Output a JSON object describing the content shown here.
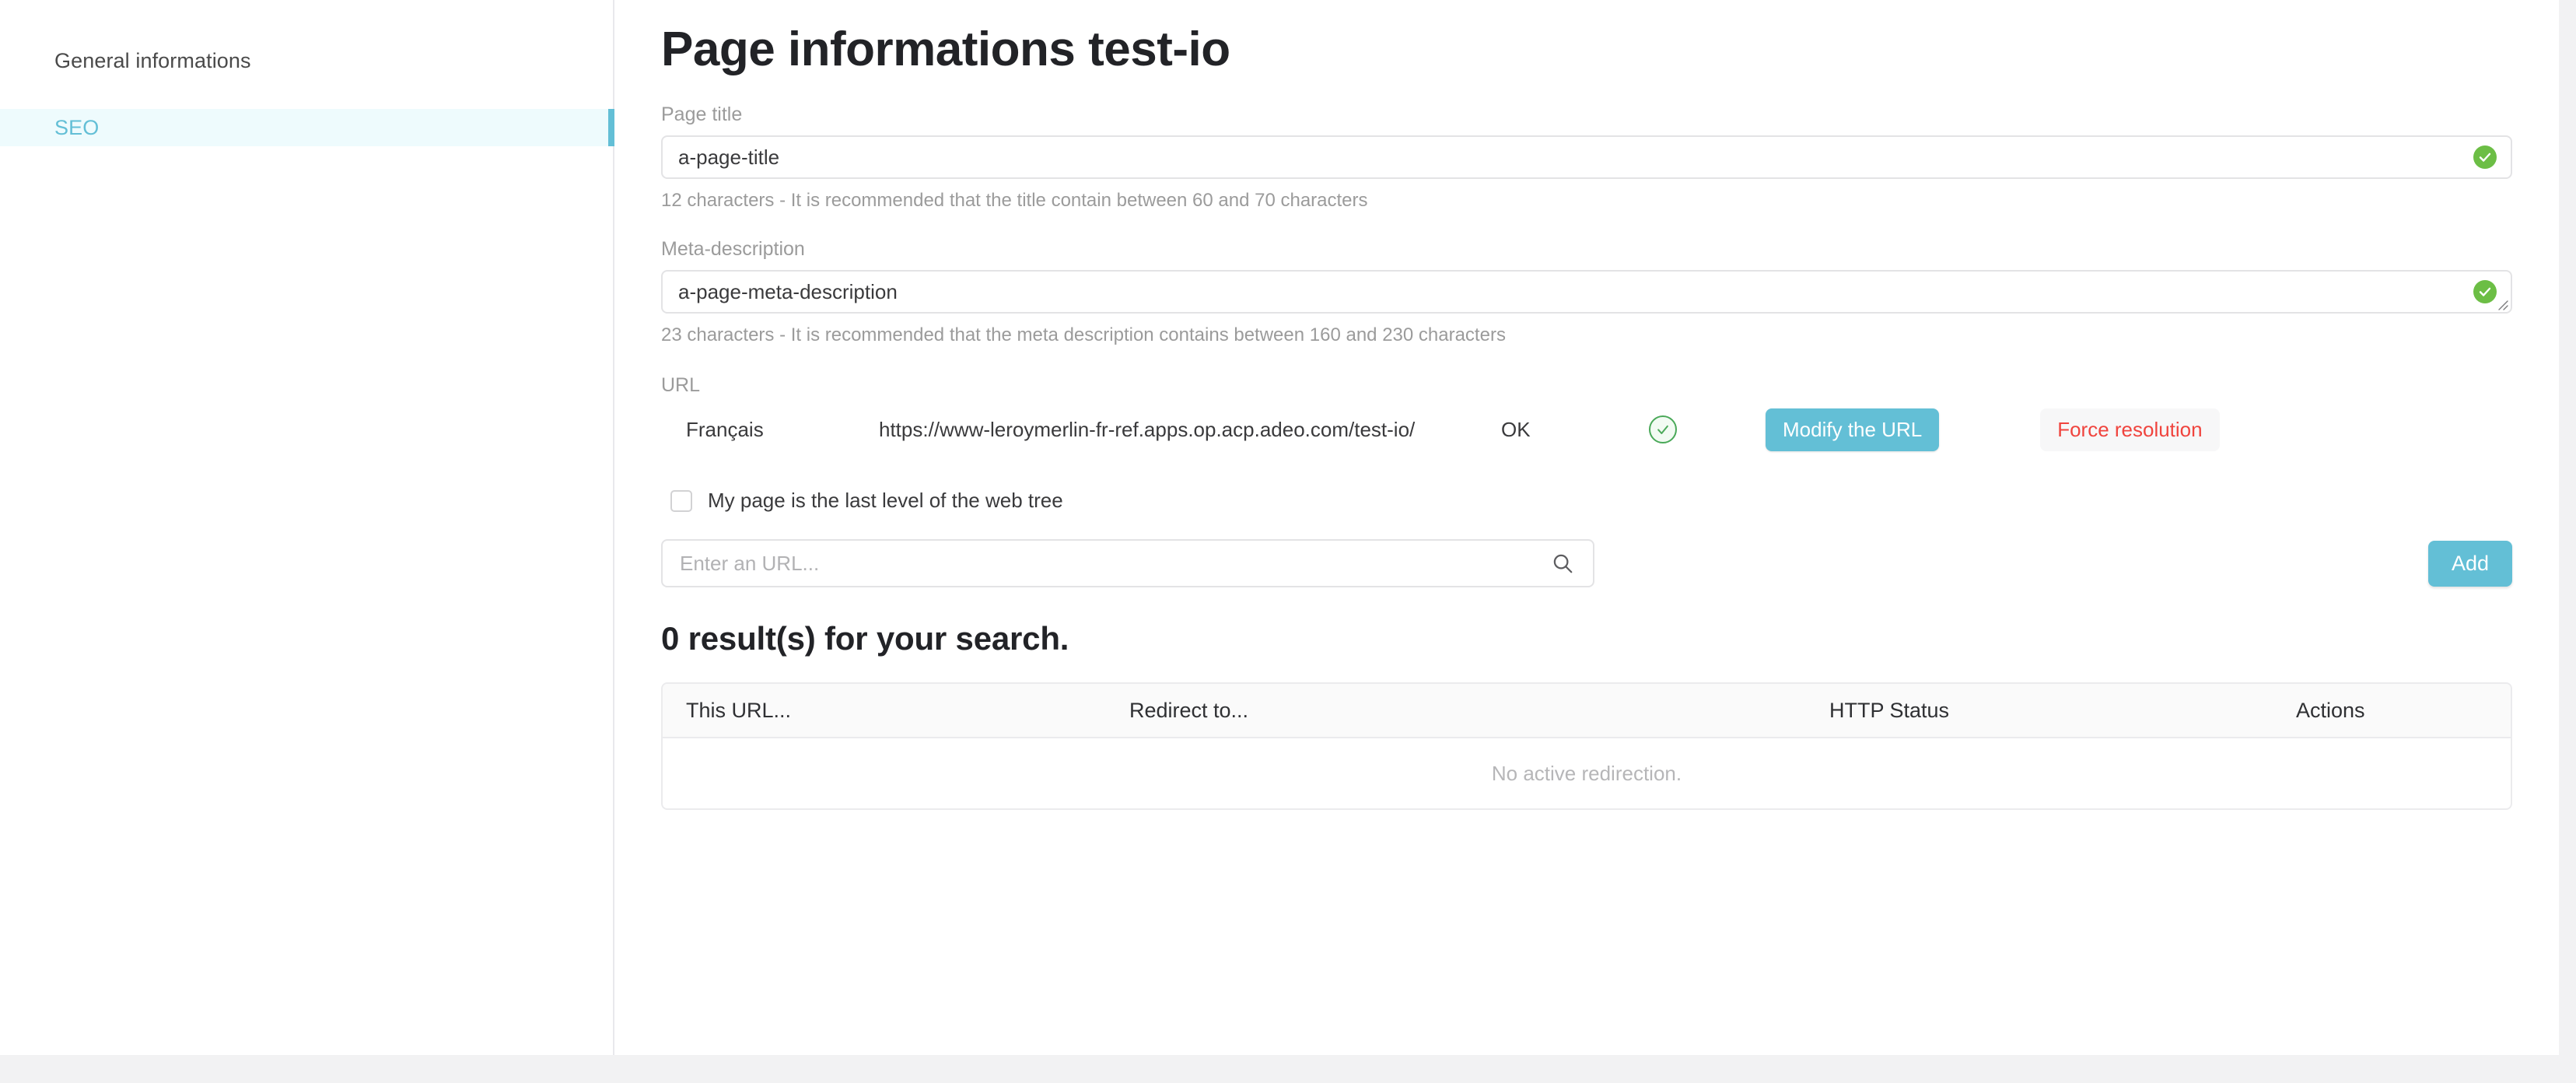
{
  "sidebar": {
    "items": [
      {
        "label": "General informations",
        "active": false
      },
      {
        "label": "SEO",
        "active": true
      }
    ]
  },
  "main": {
    "page_title": "Page informations test-io",
    "page_title_field": {
      "label": "Page title",
      "value": "a-page-title",
      "hint": "12 characters - It is recommended that the title contain between 60 and 70 characters",
      "status_icon": "check-circle-filled-icon"
    },
    "meta_description_field": {
      "label": "Meta-description",
      "value": "a-page-meta-description",
      "hint": "23 characters - It is recommended that the meta description contains between 160 and 230 characters",
      "status_icon": "check-circle-filled-icon",
      "resize_icon": "resize-grip-icon"
    },
    "url_section": {
      "label": "URL",
      "language": "Français",
      "url": "https://www-leroymerlin-fr-ref.apps.op.acp.adeo.com/test-io/",
      "status": "OK",
      "status_icon": "check-circle-outline-icon",
      "modify_button": "Modify the URL",
      "force_button": "Force resolution"
    },
    "checkbox": {
      "label": "My page is the last level of the web tree",
      "checked": false
    },
    "search": {
      "placeholder": "Enter an URL...",
      "value": "",
      "icon": "search-icon",
      "add_button": "Add"
    },
    "results": {
      "title": "0 result(s) for your search.",
      "columns": [
        "This URL...",
        "Redirect to...",
        "HTTP Status",
        "Actions"
      ],
      "rows": [],
      "empty_message": "No active redirection."
    }
  },
  "colors": {
    "accent": "#63bfd6",
    "active_nav_bg": "#eefbfd",
    "success": "#6cbe45",
    "success_outline": "#4aa959",
    "danger": "#f0443e",
    "page_bg": "#f2f2f3"
  }
}
